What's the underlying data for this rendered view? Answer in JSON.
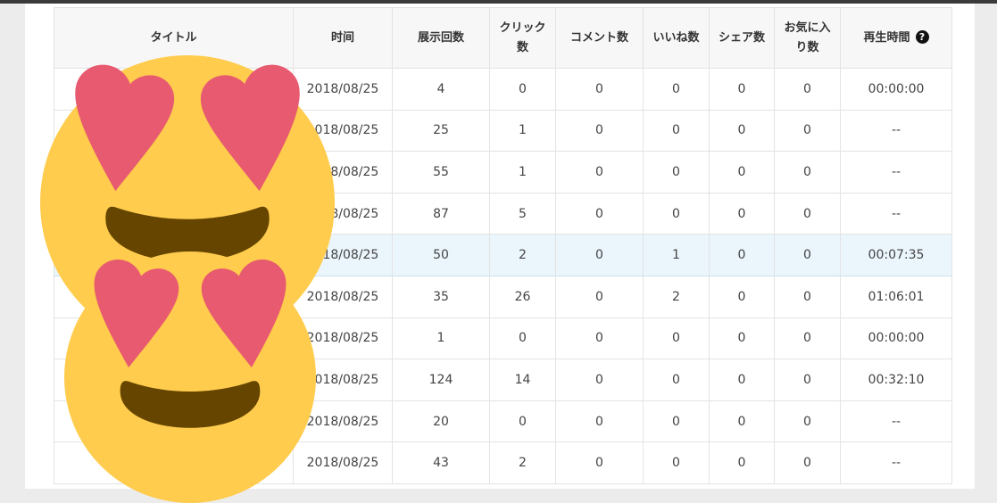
{
  "columns": [
    "タイトル",
    "时间",
    "展示回数",
    "クリック数",
    "コメント数",
    "いいね数",
    "シェア数",
    "お気に入り数",
    "再生時間"
  ],
  "rows": [
    {
      "title": "",
      "time": "2018/08/25",
      "impressions": "4",
      "clicks": "0",
      "comments": "0",
      "likes": "0",
      "shares": "0",
      "favorites": "0",
      "playtime": "00:00:00"
    },
    {
      "title": "",
      "time": "2018/08/25",
      "impressions": "25",
      "clicks": "1",
      "comments": "0",
      "likes": "0",
      "shares": "0",
      "favorites": "0",
      "playtime": "--"
    },
    {
      "title": "",
      "time": "2018/08/25",
      "impressions": "55",
      "clicks": "1",
      "comments": "0",
      "likes": "0",
      "shares": "0",
      "favorites": "0",
      "playtime": "--"
    },
    {
      "title": "",
      "time": "2018/08/25",
      "impressions": "87",
      "clicks": "5",
      "comments": "0",
      "likes": "0",
      "shares": "0",
      "favorites": "0",
      "playtime": "--"
    },
    {
      "title": "",
      "time": "2018/08/25",
      "impressions": "50",
      "clicks": "2",
      "comments": "0",
      "likes": "1",
      "shares": "0",
      "favorites": "0",
      "playtime": "00:07:35"
    },
    {
      "title": "",
      "time": "2018/08/25",
      "impressions": "35",
      "clicks": "26",
      "comments": "0",
      "likes": "2",
      "shares": "0",
      "favorites": "0",
      "playtime": "01:06:01"
    },
    {
      "title": "",
      "time": "2018/08/25",
      "impressions": "1",
      "clicks": "0",
      "comments": "0",
      "likes": "0",
      "shares": "0",
      "favorites": "0",
      "playtime": "00:00:00"
    },
    {
      "title": "",
      "time": "2018/08/25",
      "impressions": "124",
      "clicks": "14",
      "comments": "0",
      "likes": "0",
      "shares": "0",
      "favorites": "0",
      "playtime": "00:32:10"
    },
    {
      "title": "",
      "time": "2018/08/25",
      "impressions": "20",
      "clicks": "0",
      "comments": "0",
      "likes": "0",
      "shares": "0",
      "favorites": "0",
      "playtime": "--"
    },
    {
      "title": "",
      "time": "2018/08/25",
      "impressions": "43",
      "clicks": "2",
      "comments": "0",
      "likes": "0",
      "shares": "0",
      "favorites": "0",
      "playtime": "--"
    }
  ],
  "highlighted_row": 4,
  "icons": {
    "help": "question-circle-icon",
    "sticker": "heart-eyes-emoji"
  },
  "help_glyph": "?",
  "colors": {
    "highlight": "#eaf5fc",
    "emoji_face": "#ffcc4d",
    "emoji_heart": "#e75a70",
    "emoji_mouth": "#664500"
  }
}
